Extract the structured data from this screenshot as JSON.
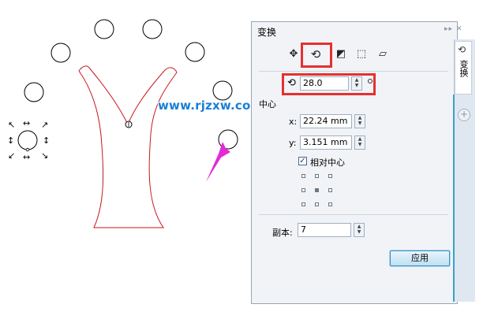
{
  "canvas": {
    "watermark": "www.rjzxw.com"
  },
  "panel": {
    "title": "变换",
    "window_controls": "▸▸ ✕",
    "tools": [
      "position-tool",
      "rotate-tool",
      "mirror-tool",
      "size-tool",
      "skew-tool"
    ],
    "angle": {
      "value": "28.0"
    },
    "center_section": {
      "label": "中心"
    },
    "x_field": {
      "label": "x:",
      "value": "22.24 mm"
    },
    "y_field": {
      "label": "y:",
      "value": "3.151 mm"
    },
    "relative_center": {
      "label": "相对中心",
      "checked": true
    },
    "copies": {
      "label": "副本:",
      "value": "7"
    },
    "apply_label": "应用"
  },
  "sidebar": {
    "tab_label": "变换"
  },
  "colors": {
    "highlight": "#e53030",
    "arrow": "#e22bd6",
    "tree_outline": "#c8171e",
    "watermark": "#1a7fd6"
  }
}
